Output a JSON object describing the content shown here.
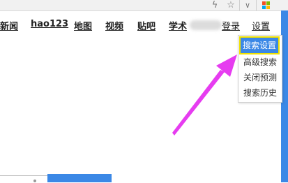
{
  "browser": {
    "icons": [
      "lightning-icon",
      "star-icon",
      "chevron-down-icon",
      "windows-logo-icon"
    ],
    "glyphs": {
      "lightning": "ϟ",
      "star": "☆",
      "chevron": "∨"
    }
  },
  "nav": {
    "items": [
      {
        "label": "新闻",
        "bold": true
      },
      {
        "label": "hao123",
        "bold": true
      },
      {
        "label": "地图",
        "bold": true
      },
      {
        "label": "视频",
        "bold": true
      },
      {
        "label": "贴吧",
        "bold": true
      },
      {
        "label": "学术",
        "bold": true
      },
      {
        "label": "登录",
        "bold": false
      },
      {
        "label": "设置",
        "bold": false
      }
    ]
  },
  "settings_menu": {
    "items": [
      "搜索设置",
      "高级搜索",
      "关闭预测",
      "搜索历史"
    ],
    "highlighted_index": 0
  },
  "colors": {
    "accent_blue": "#3b88e6",
    "highlight_outline": "#f0e000",
    "annotation_arrow": "#e63cf0"
  }
}
